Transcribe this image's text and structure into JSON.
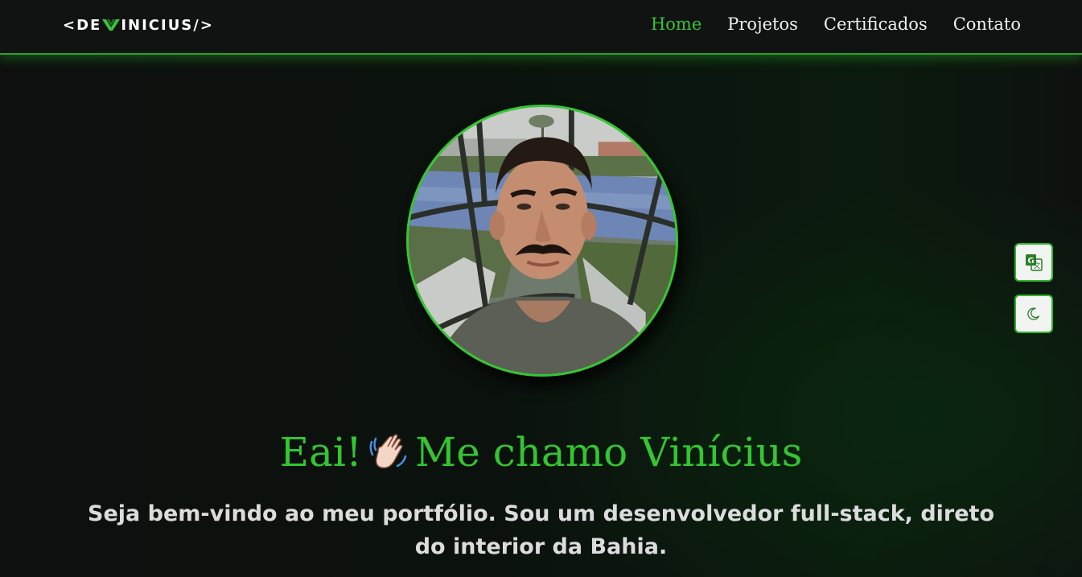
{
  "header": {
    "logo": {
      "prefix": "<DE",
      "suffix": "INICIUS/>",
      "mark_icon": "v-chevron-logo",
      "accent_color": "#3cc23a"
    },
    "nav": [
      {
        "label": "Home",
        "active": true
      },
      {
        "label": "Projetos",
        "active": false
      },
      {
        "label": "Certificados",
        "active": false
      },
      {
        "label": "Contato",
        "active": false
      }
    ]
  },
  "hero": {
    "avatar_alt": "profile-photo",
    "title_before": "Eai!",
    "title_emoji": "waving-hand-icon",
    "title_after": "Me chamo Vinícius",
    "subtitle": "Seja bem-vindo ao meu portfólio. Sou um desenvolvedor full-stack, direto do interior da Bahia."
  },
  "floating_buttons": [
    {
      "name": "translate-button",
      "icon": "translate-icon"
    },
    {
      "name": "theme-toggle-button",
      "icon": "moon-icon"
    }
  ],
  "colors": {
    "accent": "#34c532",
    "background": "#0f1110",
    "text": "#dcdcdc"
  }
}
